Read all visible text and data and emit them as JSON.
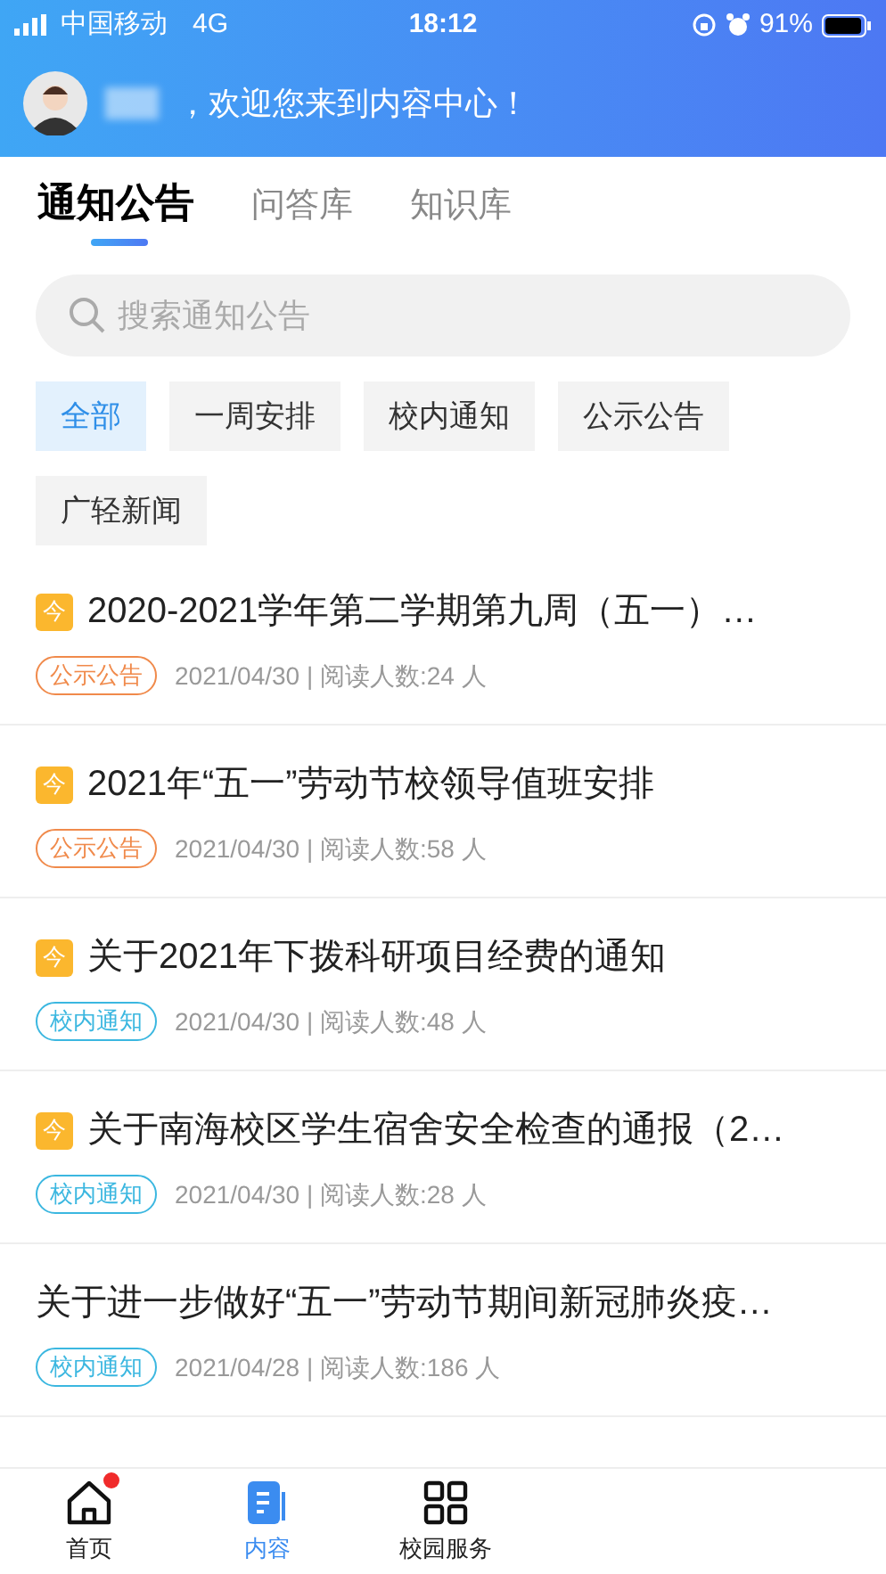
{
  "status_bar": {
    "carrier": "中国移动",
    "network": "4G",
    "time": "18:12",
    "battery": "91%"
  },
  "header": {
    "greeting": "，欢迎您来到内容中心！"
  },
  "tabs": [
    {
      "label": "通知公告",
      "selected": true
    },
    {
      "label": "问答库",
      "selected": false
    },
    {
      "label": "知识库",
      "selected": false
    }
  ],
  "search": {
    "placeholder": "搜索通知公告"
  },
  "filters": [
    {
      "label": "全部",
      "selected": true
    },
    {
      "label": "一周安排",
      "selected": false
    },
    {
      "label": "校内通知",
      "selected": false
    },
    {
      "label": "公示公告",
      "selected": false
    },
    {
      "label": "广轻新闻",
      "selected": false
    }
  ],
  "notices": [
    {
      "today": true,
      "badge": "今",
      "title": "2020-2021学年第二学期第九周（五一）…",
      "tag": "公示公告",
      "color": "#f08a4b",
      "meta": "2021/04/30 | 阅读人数:24 人"
    },
    {
      "today": true,
      "badge": "今",
      "title": "2021年“五一”劳动节校领导值班安排",
      "tag": "公示公告",
      "color": "#f08a4b",
      "meta": "2021/04/30 | 阅读人数:58 人"
    },
    {
      "today": true,
      "badge": "今",
      "title": "关于2021年下拨科研项目经费的通知",
      "tag": "校内通知",
      "color": "#3bb7e0",
      "meta": "2021/04/30 | 阅读人数:48 人"
    },
    {
      "today": true,
      "badge": "今",
      "title": "关于南海校区学生宿舍安全检查的通报（2…",
      "tag": "校内通知",
      "color": "#3bb7e0",
      "meta": "2021/04/30 | 阅读人数:28 人"
    },
    {
      "today": false,
      "title": "关于进一步做好“五一”劳动节期间新冠肺炎疫…",
      "tag": "校内通知",
      "color": "#3bb7e0",
      "meta": "2021/04/28 | 阅读人数:186 人"
    }
  ],
  "nav": [
    {
      "label": "首页",
      "kind": "home",
      "selected": false,
      "dot": true
    },
    {
      "label": "内容",
      "kind": "doc",
      "selected": true,
      "dot": false
    },
    {
      "label": "校园服务",
      "kind": "grid",
      "selected": false,
      "dot": false
    }
  ]
}
